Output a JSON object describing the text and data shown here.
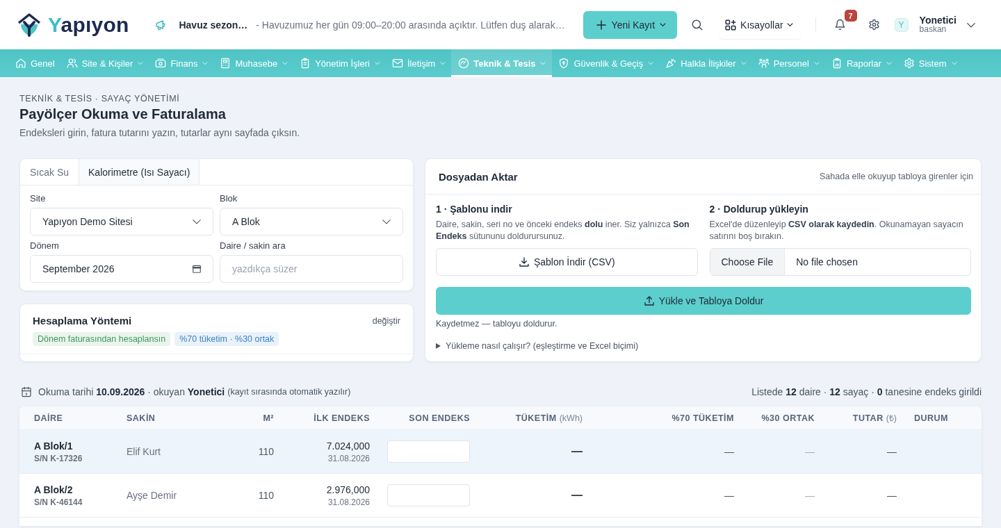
{
  "header": {
    "logo": "Yapıyon",
    "announcement": {
      "title": "Havuz sezon…",
      "text": "- Havuzumuz her gün 09:00–20:00 arasında açıktır. Lütfen duş alarak…"
    },
    "new_button": "Yeni Kayıt",
    "shortcuts": "Kısayollar",
    "notifications": {
      "count": "7"
    },
    "user": {
      "initial": "Y",
      "name": "Yonetici",
      "role": "baskan"
    }
  },
  "nav": [
    {
      "label": "Genel",
      "dropdown": false,
      "selected": false
    },
    {
      "label": "Site & Kişiler",
      "dropdown": true,
      "selected": false
    },
    {
      "label": "Finans",
      "dropdown": true,
      "selected": false
    },
    {
      "label": "Muhasebe",
      "dropdown": true,
      "selected": false
    },
    {
      "label": "Yönetim İşleri",
      "dropdown": true,
      "selected": false
    },
    {
      "label": "İletişim",
      "dropdown": true,
      "selected": false
    },
    {
      "label": "Teknik & Tesis",
      "dropdown": true,
      "selected": true
    },
    {
      "label": "Güvenlik & Geçiş",
      "dropdown": true,
      "selected": false
    },
    {
      "label": "Halkla İlişkiler",
      "dropdown": true,
      "selected": false
    },
    {
      "label": "Personel",
      "dropdown": true,
      "selected": false
    },
    {
      "label": "Raporlar",
      "dropdown": true,
      "selected": false
    },
    {
      "label": "Sistem",
      "dropdown": true,
      "selected": false
    }
  ],
  "page": {
    "breadcrumb": "TEKNİK & TESİS · SAYAÇ YÖNETİMİ",
    "title": "Payölçer Okuma ve Faturalama",
    "subtitle": "Endeksleri girin, fatura tutarını yazın, tutarlar aynı sayfada çıksın."
  },
  "meter_tabs": [
    {
      "label": "Sıcak Su",
      "selected": false
    },
    {
      "label": "Kalorimetre (Isı Sayacı)",
      "selected": true
    }
  ],
  "filters": [
    {
      "kind": "select",
      "label": "Site",
      "value": "Yapıyon Demo Sitesi"
    },
    {
      "kind": "select",
      "label": "Blok",
      "value": "A Blok"
    },
    {
      "kind": "month",
      "label": "Dönem",
      "value": "September 2026"
    },
    {
      "kind": "search",
      "label": "Daire / sakin ara",
      "placeholder": "yazdıkça süzer"
    }
  ],
  "calc_method": {
    "title": "Hesaplama Yöntemi",
    "action": "değiştir",
    "tags": [
      {
        "text": "Dönem faturasından hesaplansın",
        "color": "#3d9a5c"
      },
      {
        "text": "%70 tüketim · %30 ortak",
        "color": "#3b82c4"
      }
    ]
  },
  "import": {
    "title": "Dosyadan Aktar",
    "hint": "Sahada elle okuyup tabloya girenler için",
    "steps": [
      {
        "title": "1 · Şablonu indir",
        "text": "Daire, sakin, seri no ve önceki endeks **dolu** iner. Siz yalnızca **Son Endeks** sütununu doldurursunuz."
      },
      {
        "title": "2 · Doldurup yükleyin",
        "text": "Excel'de düzenleyip **CSV olarak kaydedin**. Okunamayan sayacın satırını boş bırakın."
      }
    ],
    "download_button": "Şablon İndir (CSV)",
    "file": {
      "button": "Choose File",
      "status": "No file chosen"
    },
    "upload_button": "Yükle ve Tabloya Doldur",
    "note": "Kaydetmez — tabloyu doldurur.",
    "help": {
      "label": "Yükleme nasıl çalışır? (eşleştirme ve Excel biçimi)",
      "expanded": false
    }
  },
  "reading_info": {
    "text": "Okuma tarihi **10.09.2026** · okuyan **Yonetici**",
    "note": "(kayıt sırasında otomatik yazılır)",
    "summary": "Listede **12** daire · **12** sayaç · **0** tanesine endeks girildi"
  },
  "table": {
    "columns": [
      {
        "label": "DAİRE"
      },
      {
        "label": "SAKİN"
      },
      {
        "label": "M²"
      },
      {
        "label": "İLK ENDEKS"
      },
      {
        "label": "SON ENDEKS"
      },
      {
        "label": "TÜKETİM",
        "unit": "(kWh)"
      },
      {
        "label": "%70 TÜKETİM"
      },
      {
        "label": "%30 ORTAK"
      },
      {
        "label": "TUTAR",
        "unit": "(₺)"
      },
      {
        "label": "DURUM"
      }
    ],
    "rows": [
      {
        "highlighted": true,
        "unit": "A Blok/1",
        "serial": "S/N K-17326",
        "resident": "Elif Kurt",
        "area": "110",
        "previous_index": "7.024,000",
        "previous_date": "31.08.2026",
        "consumption": "—",
        "share_70": "—",
        "share_30": "—",
        "amount": "—"
      },
      {
        "highlighted": false,
        "unit": "A Blok/2",
        "serial": "S/N K-46144",
        "resident": "Ayşe Demir",
        "area": "110",
        "previous_index": "2.976,000",
        "previous_date": "31.08.2026",
        "consumption": "—",
        "share_70": "—",
        "share_30": "—",
        "amount": "—"
      }
    ]
  }
}
